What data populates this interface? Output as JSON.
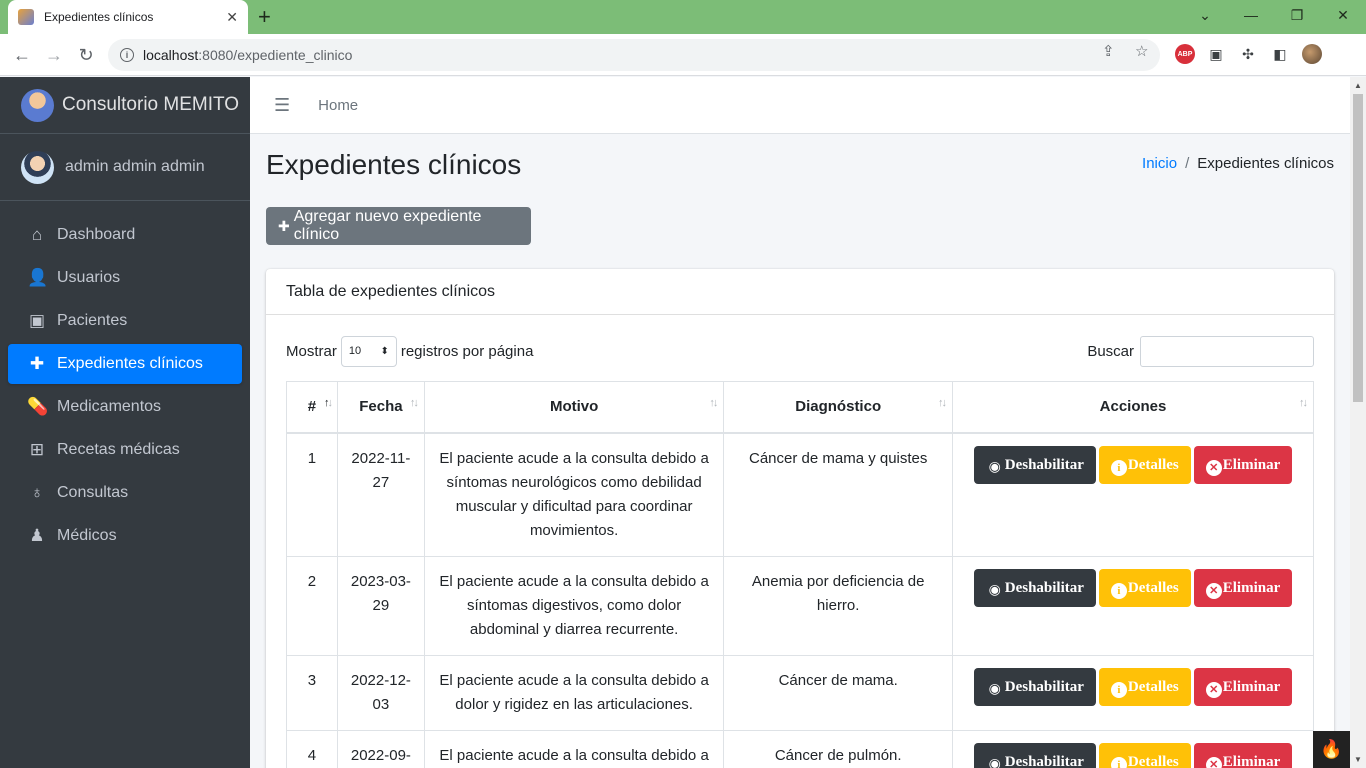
{
  "browser": {
    "tab_title": "Expedientes clínicos",
    "tab_close": "✕",
    "new_tab": "+",
    "url_host": "localhost",
    "url_path": ":8080/expediente_clinico",
    "abp": "ABP"
  },
  "sidebar": {
    "brand": "Consultorio MEMITO",
    "user": "admin admin admin",
    "items": [
      {
        "label": "Dashboard",
        "icon": "home-icon",
        "glyph": "⌂"
      },
      {
        "label": "Usuarios",
        "icon": "user-icon",
        "glyph": "👤"
      },
      {
        "label": "Pacientes",
        "icon": "id-card-icon",
        "glyph": "▣"
      },
      {
        "label": "Expedientes clínicos",
        "icon": "medkit-icon",
        "glyph": "✚",
        "active": true
      },
      {
        "label": "Medicamentos",
        "icon": "pills-icon",
        "glyph": "💊"
      },
      {
        "label": "Recetas médicas",
        "icon": "plus-square-icon",
        "glyph": "⊞"
      },
      {
        "label": "Consultas",
        "icon": "stethoscope-icon",
        "glyph": "♁"
      },
      {
        "label": "Médicos",
        "icon": "doctor-icon",
        "glyph": "♟"
      }
    ]
  },
  "topnav": {
    "home": "Home"
  },
  "page": {
    "title": "Expedientes clínicos",
    "breadcrumb_home": "Inicio",
    "breadcrumb_sep": "/",
    "breadcrumb_current": "Expedientes clínicos",
    "add_button": "Agregar nuevo expediente clínico"
  },
  "card": {
    "title": "Tabla de expedientes clínicos",
    "show_label": "Mostrar",
    "page_size": "10",
    "per_page_label": "registros por página",
    "search_label": "Buscar",
    "columns": [
      "#",
      "Fecha",
      "Motivo",
      "Diagnóstico",
      "Acciones"
    ],
    "actions": {
      "disable": "Deshabilitar",
      "details": "Detalles",
      "delete": "Eliminar"
    },
    "rows": [
      {
        "id": "1",
        "fecha": "2022-11-27",
        "motivo": "El paciente acude a la consulta debido a síntomas neurológicos como debilidad muscular y dificultad para coordinar movimientos.",
        "diagnostico": "Cáncer de mama y quistes"
      },
      {
        "id": "2",
        "fecha": "2023-03-29",
        "motivo": "El paciente acude a la consulta debido a síntomas digestivos, como dolor abdominal y diarrea recurrente.",
        "diagnostico": "Anemia por deficiencia de hierro."
      },
      {
        "id": "3",
        "fecha": "2022-12-03",
        "motivo": "El paciente acude a la consulta debido a dolor y rigidez en las articulaciones.",
        "diagnostico": "Cáncer de mama."
      },
      {
        "id": "4",
        "fecha": "2022-09-",
        "motivo": "El paciente acude a la consulta debido a",
        "diagnostico": "Cáncer de pulmón."
      }
    ]
  }
}
